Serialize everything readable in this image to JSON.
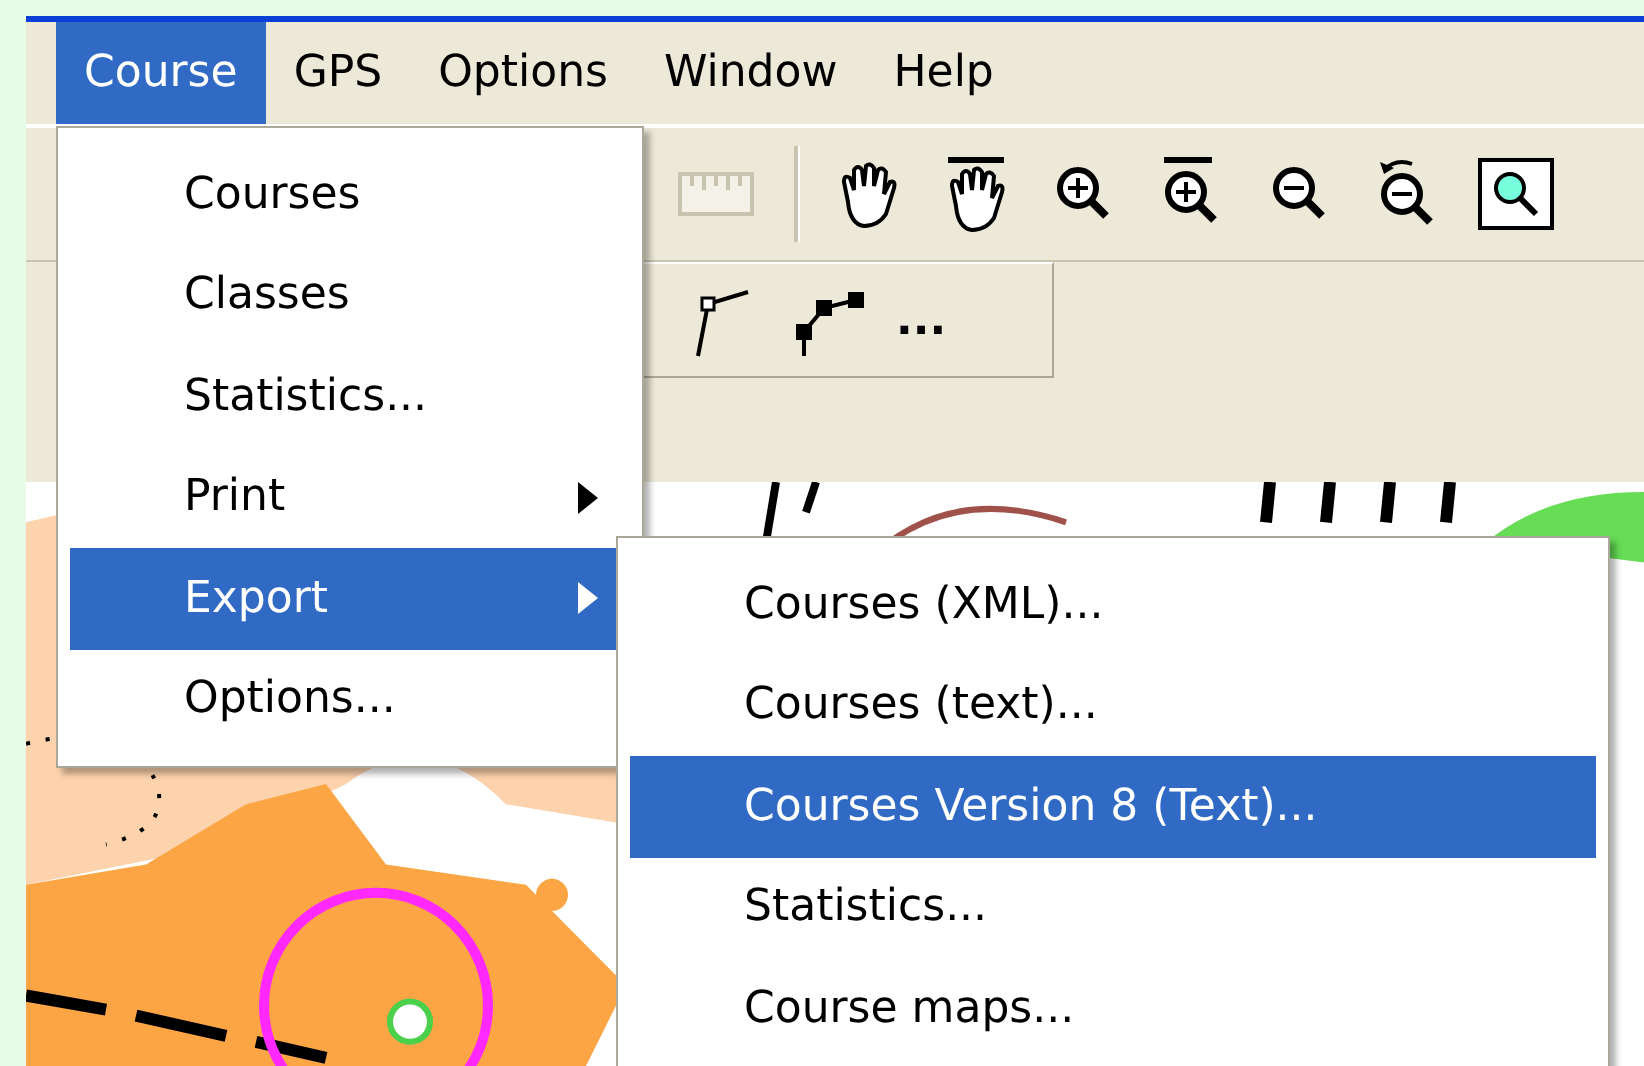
{
  "menubar": [
    {
      "label": "Course",
      "selected": true
    },
    {
      "label": "GPS",
      "selected": false
    },
    {
      "label": "Options",
      "selected": false
    },
    {
      "label": "Window",
      "selected": false
    },
    {
      "label": "Help",
      "selected": false
    }
  ],
  "course_menu": {
    "items": [
      {
        "label": "Courses",
        "has_submenu": false,
        "selected": false
      },
      {
        "label": "Classes",
        "has_submenu": false,
        "selected": false
      },
      {
        "label": "Statistics...",
        "has_submenu": false,
        "selected": false
      },
      {
        "label": "Print",
        "has_submenu": true,
        "selected": false
      },
      {
        "label": "Export",
        "has_submenu": true,
        "selected": true
      },
      {
        "label": "Options...",
        "has_submenu": false,
        "selected": false
      }
    ]
  },
  "export_submenu": {
    "items": [
      {
        "label": "Courses (XML)...",
        "selected": false
      },
      {
        "label": "Courses (text)...",
        "selected": false
      },
      {
        "label": "Courses Version 8 (Text)...",
        "selected": true
      },
      {
        "label": "Statistics...",
        "selected": false
      },
      {
        "label": "Course maps...",
        "selected": false
      }
    ]
  },
  "toolbar_2": {
    "more_button": "..."
  }
}
